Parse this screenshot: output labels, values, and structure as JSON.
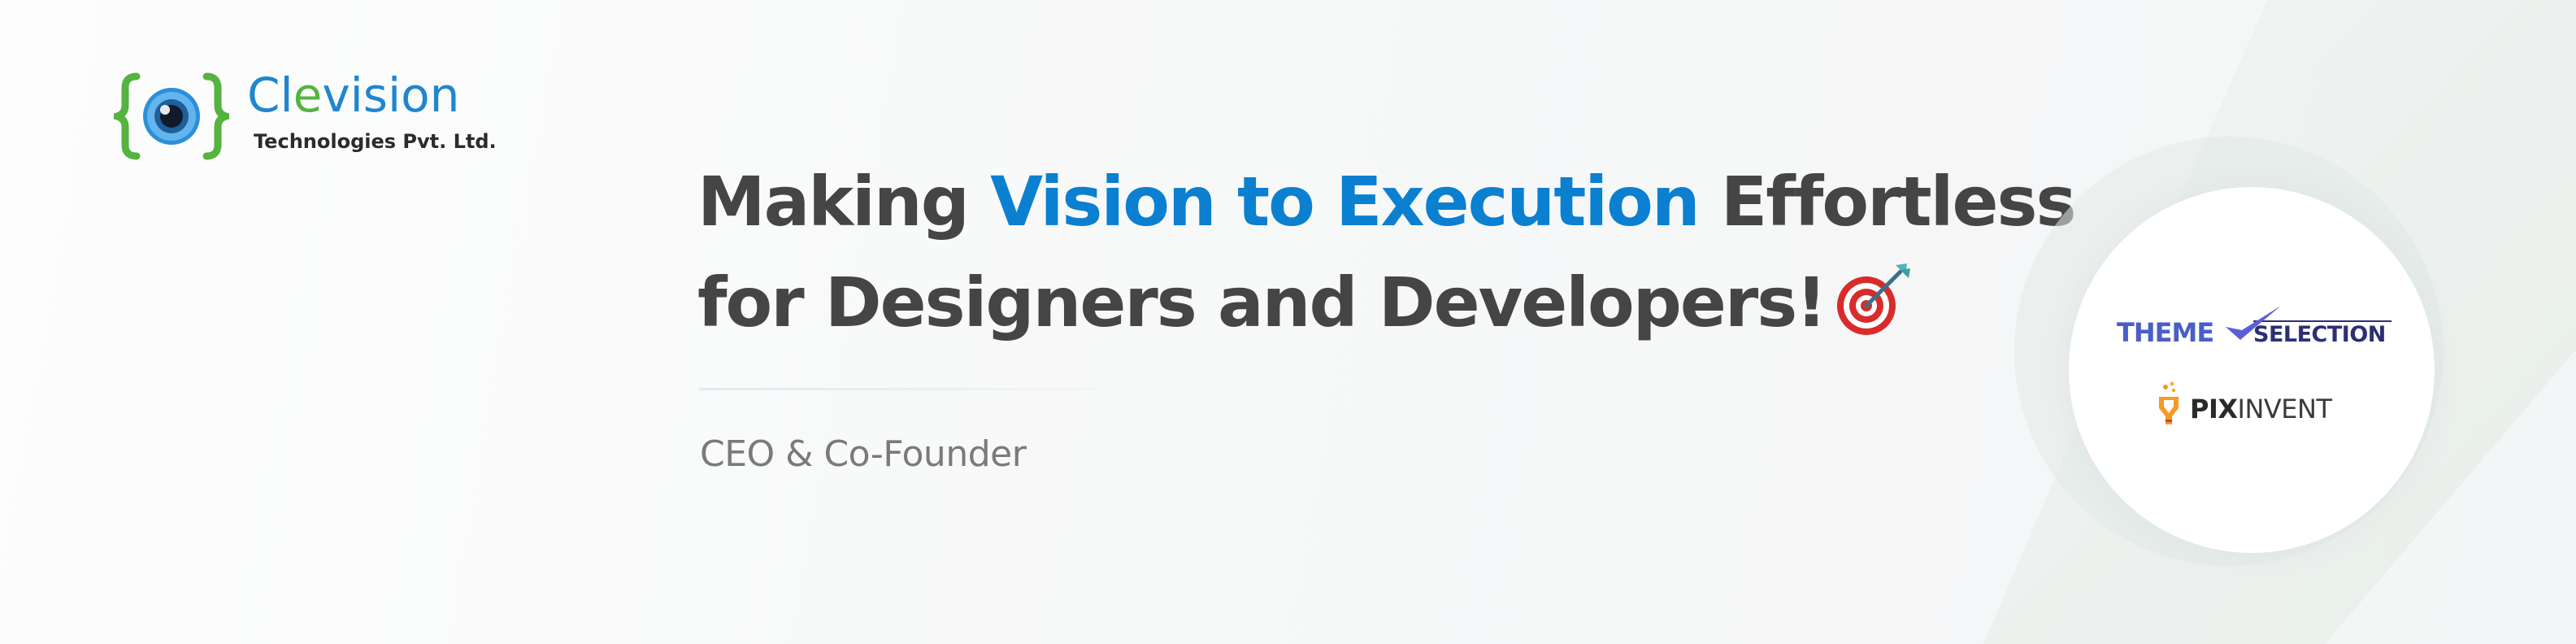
{
  "logo": {
    "icon": "eye-in-braces-icon",
    "word_part1": "Cl",
    "word_part2": "e",
    "word_part3": "vision",
    "subtitle": "Technologies Pvt. Ltd."
  },
  "headline": {
    "line1_prefix": "Making ",
    "line1_accent": "Vision to Execution",
    "line1_suffix": " Effortless",
    "line2": "for Designers and Developers!",
    "emoji": "direct-hit-target-icon"
  },
  "role": "CEO & Co-Founder",
  "brands": {
    "themeselection": {
      "part1": "THEME",
      "part2": "SELECTION",
      "icon": "checkmark-icon"
    },
    "pixinvent": {
      "part1": "PIX",
      "part2": "INVENT",
      "icon": "lightbulb-icon"
    }
  },
  "colors": {
    "headline_text": "#454545",
    "accent_blue": "#0b7fd0",
    "logo_blue": "#1f86cf",
    "logo_green": "#55b340",
    "role_text": "#7a7a7a",
    "themeselection_blue": "#4a5ec6",
    "themeselection_navy": "#2d2f74",
    "pixinvent_orange": "#f59a23"
  }
}
